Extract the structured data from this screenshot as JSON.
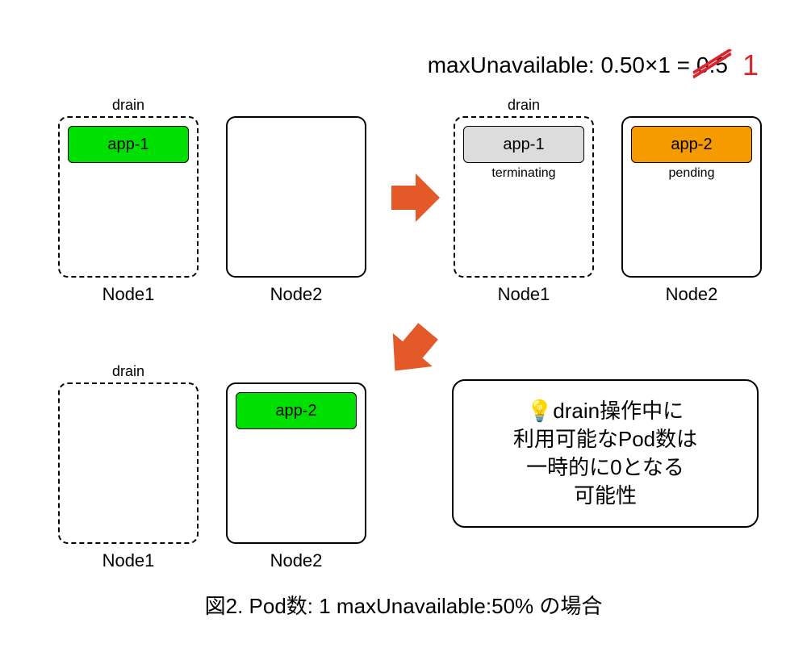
{
  "formula": {
    "prefix": "maxUnavailable: 0.50×1 =",
    "struck": "0.5",
    "corrected": "1"
  },
  "labels": {
    "drain": "drain",
    "terminating": "terminating",
    "pending": "pending"
  },
  "pods": {
    "app1": "app-1",
    "app2": "app-2"
  },
  "nodes": {
    "node1": "Node1",
    "node2": "Node2"
  },
  "note": {
    "line1_pre": "💡",
    "line1": "drain操作中に",
    "line2": "利用可能なPod数は",
    "line3": "一時的に0となる",
    "line4": "可能性"
  },
  "caption": "図2. Pod数: 1 maxUnavailable:50% の場合",
  "colors": {
    "arrow": "#e35a28",
    "strike": "#d7262d"
  }
}
